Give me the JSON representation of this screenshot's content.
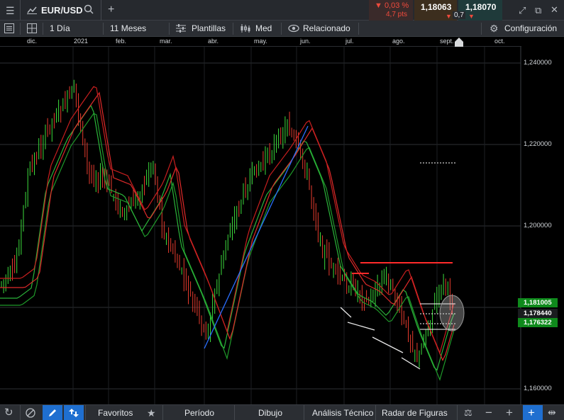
{
  "top": {
    "symbol": "EUR/USD",
    "change_pct": "▼ 0,03 %",
    "change_pts": "4,7 pts",
    "bid": "1,18063",
    "ask": "1,18070",
    "spread": "0,7"
  },
  "toolbar": {
    "interval": "1 Día",
    "range": "11 Meses",
    "templates": "Plantillas",
    "price_type": "Med",
    "related": "Relacionado",
    "settings": "Configuración"
  },
  "months": [
    "dic.",
    "2021",
    "feb.",
    "mar.",
    "abr.",
    "may.",
    "jun.",
    "jul.",
    "ago.",
    "sept.",
    "oct."
  ],
  "price_axis": {
    "labels": [
      "1,240000",
      "1,220000",
      "1,200000",
      "1,160000"
    ],
    "boxes": [
      "1,181005",
      "1,178440",
      "1,176322"
    ]
  },
  "bottom": {
    "favorites": "Favoritos",
    "period": "Período",
    "drawing": "Dibujo",
    "technical": "Análisis Técnico",
    "patterns": "Radar de Figuras"
  },
  "colors": {
    "up": "#3ddc3d",
    "down": "#e83b2e",
    "accent_up": "#0f8a1c",
    "change_red": "#f04a3c"
  }
}
